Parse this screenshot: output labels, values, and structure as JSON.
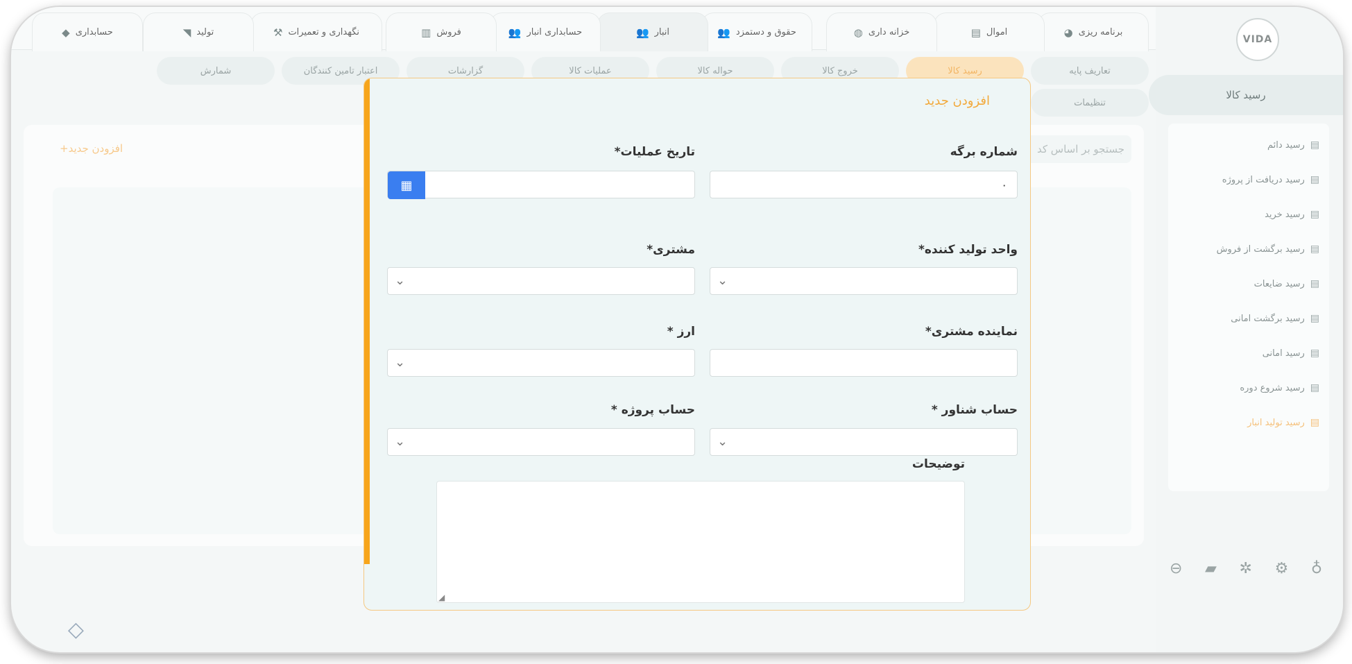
{
  "topbar": {
    "tabs": [
      {
        "label": "برنامه ریزی",
        "icon": "pie-chart-icon"
      },
      {
        "label": "اموال",
        "icon": "document-money-icon"
      },
      {
        "label": "خزانه داری",
        "icon": "coins-icon"
      },
      {
        "label": "حقوق و دستمزد",
        "icon": "users-icon"
      },
      {
        "label": "انبار",
        "icon": "users-icon"
      },
      {
        "label": "حسابداری انبار",
        "icon": "users-icon"
      },
      {
        "label": "فروش",
        "icon": "bar-chart-icon"
      },
      {
        "label": "نگهداری و تعمیرات",
        "icon": "tools-icon"
      },
      {
        "label": "تولید",
        "icon": "tag-icon"
      },
      {
        "label": "حسابداری",
        "icon": "diamond-icon"
      }
    ]
  },
  "subtabs": {
    "items": [
      "تعاریف پایه",
      "رسید کالا",
      "خروج کالا",
      "حواله کالا",
      "عملیات کالا",
      "گزارشات",
      "اعتبار تامین کنندگان",
      "شمارش",
      "تنظیمات"
    ]
  },
  "sidebar": {
    "logo_text": "VIDA",
    "header": "رسید کالا",
    "items": [
      {
        "label": "رسید دائم"
      },
      {
        "label": "رسید دریافت از پروژه"
      },
      {
        "label": "رسید خرید"
      },
      {
        "label": "رسید برگشت از فروش"
      },
      {
        "label": "رسید ضایعات"
      },
      {
        "label": "رسید برگشت امانی"
      },
      {
        "label": "رسید امانی"
      },
      {
        "label": "رسید شروع دوره"
      },
      {
        "label": "رسید تولید انبار"
      }
    ]
  },
  "main": {
    "add_new": "افزودن جدید+",
    "search_placeholder": "جستجو بر اساس کد"
  },
  "modal": {
    "title": "افزودن جدید",
    "fields": {
      "sheet_number_label": "شماره برگه",
      "sheet_number_value": "۰",
      "operation_date_label": "تاریخ عملیات*",
      "producer_unit_label": "واحد تولید کننده*",
      "customer_label": "مشتری*",
      "customer_rep_label": "نماینده مشتری*",
      "currency_label": "ارز *",
      "floating_account_label": "حساب شناور *",
      "project_account_label": "حساب پروژه *",
      "description_label": "توضیحات"
    }
  },
  "colors": {
    "accent_orange": "#f7a51b",
    "calendar_blue": "#3a7ef0"
  }
}
